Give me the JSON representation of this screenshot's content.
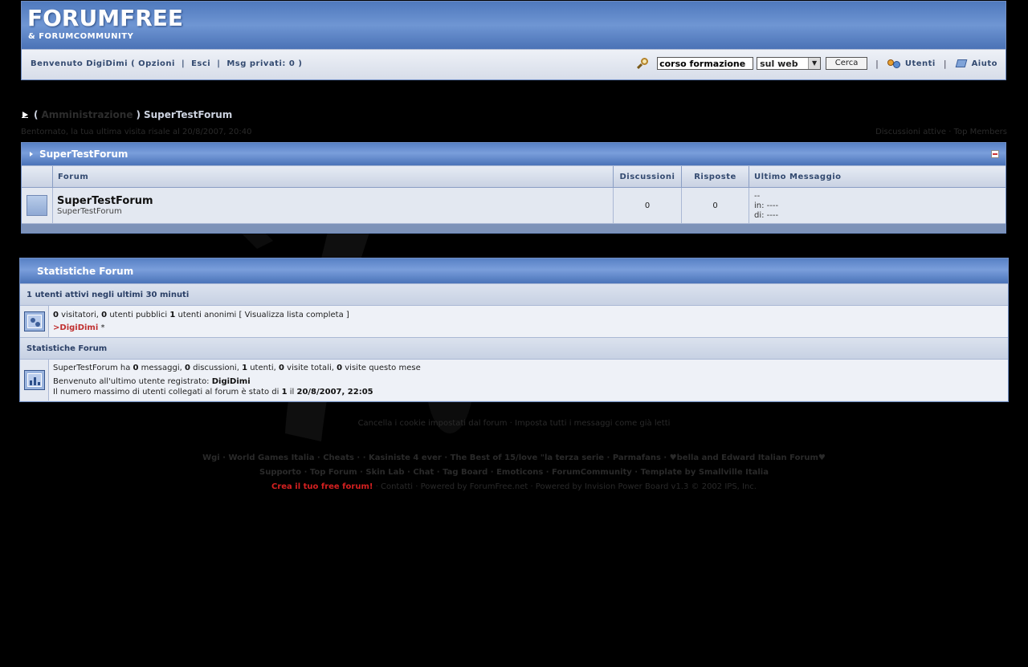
{
  "header": {
    "logo_main": "FORUMFREE",
    "logo_sub": "& FORUMCOMMUNITY",
    "welcome": "Benvenuto DigiDimi",
    "options": "( Opzioni",
    "logout": "Esci",
    "pm": "Msg privati: 0 )",
    "search_value": "corso formazione",
    "search_scope": "sul web",
    "search_button": "Cerca",
    "users_link": "Utenti",
    "help_link": "Aiuto"
  },
  "breadcrumb": {
    "open": "(",
    "admin": "Amministrazione",
    "close": ")",
    "current": "SuperTestForum"
  },
  "welcome_line": {
    "left": "Bentornato, la tua ultima visita risale al 20/8/2007, 20:40",
    "active": "Discussioni attive",
    "dot": "·",
    "top": "Top Members"
  },
  "forum_section": {
    "title": "SuperTestForum",
    "headers": {
      "forum": "Forum",
      "topics": "Discussioni",
      "replies": "Risposte",
      "last": "Ultimo Messaggio"
    },
    "rows": [
      {
        "name": "SuperTestForum",
        "desc": "SuperTestForum",
        "topics": "0",
        "replies": "0",
        "last1": "--",
        "last2": "in: ----",
        "last3": "di: ----"
      }
    ]
  },
  "stats": {
    "title": "Statistiche Forum",
    "active_header": "1 utenti attivi negli ultimi 30 minuti",
    "visitors_num": "0",
    "visitors_label": " visitatori, ",
    "public_num": "0",
    "public_label": " utenti pubblici ",
    "anon_num": "1",
    "anon_label": " utenti anonimi [ Visualizza lista completa ]",
    "online_user_prefix": ">",
    "online_user": "DigiDimi",
    "online_user_suffix": " *",
    "forum_stats_header": "Statistiche Forum",
    "line1_a": "SuperTestForum ha ",
    "msgs": "0",
    "line1_b": " messaggi, ",
    "topics": "0",
    "line1_c": " discussioni, ",
    "users": "1",
    "line1_d": " utenti, ",
    "visits": "0",
    "line1_e": " visite totali, ",
    "month": "0",
    "line1_f": " visite questo mese",
    "line2": "Benvenuto all'ultimo utente registrato: ",
    "last_user": "DigiDimi",
    "line3": "Il numero massimo di utenti collegati al forum è stato di ",
    "max_users": "1",
    "line3_b": " il ",
    "max_date": "20/8/2007, 22:05"
  },
  "footer": {
    "line1": "Cancella i cookie impostati dal forum · Imposta tutti i messaggi come già letti",
    "line2": "Wgi · World Games Italia · Cheats · · Kasiniste 4 ever · The Best of 15/love \"la terza serie · Parmafans · ♥bella and Edward Italian Forum♥",
    "line3": "Supporto · Top Forum · Skin Lab · Chat · Tag Board · Emoticons · ForumCommunity · Template by Smallville Italia",
    "create": "Crea il tuo free forum!",
    "line4_rest": " · Contatti · Powered by ForumFree.net · Powered by Invision Power Board v1.3 © 2002  IPS, Inc."
  },
  "colors": {
    "accent_blue": "#4f79bd",
    "panel": "#dde3ee",
    "red_user": "#c03030",
    "create_red": "#d42020"
  }
}
